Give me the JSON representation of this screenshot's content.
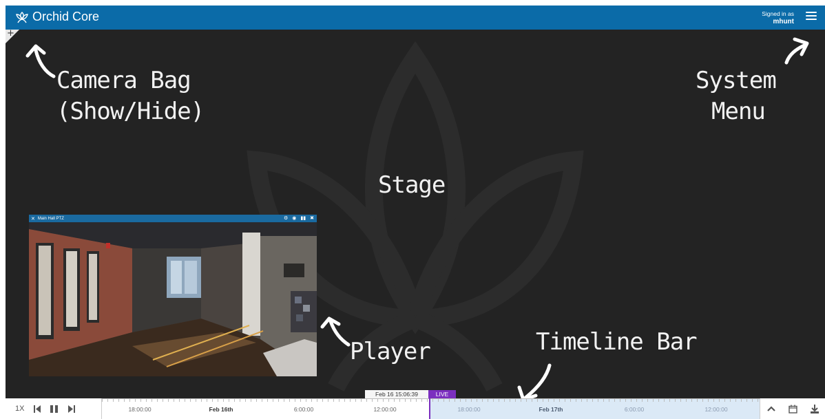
{
  "header": {
    "app_name": "Orchid Core",
    "signed_in_label": "Signed in as",
    "username": "mhunt"
  },
  "camera_bag": {
    "toggle_symbol": "+"
  },
  "annotations": {
    "camera_bag_line1": "Camera Bag",
    "camera_bag_line2": "(Show/Hide)",
    "system_menu_line1": "System",
    "system_menu_line2": "Menu",
    "stage": "Stage",
    "player": "Player",
    "timeline_bar": "Timeline Bar"
  },
  "player": {
    "title": "Main Hall PTZ",
    "icons": [
      "settings-icon",
      "camera-icon",
      "stats-icon",
      "close-icon"
    ]
  },
  "timeline": {
    "current_time": "Feb 16 15:06:39",
    "live_label": "LIVE",
    "speed": "1X",
    "labels": [
      "18:00:00",
      "Feb 16th",
      "6:00:00",
      "12:00:00",
      "18:00:00",
      "Feb 17th",
      "6:00:00",
      "12:00:00"
    ]
  },
  "colors": {
    "header": "#0b6ba8",
    "stage": "#232323",
    "live": "#7b2fbf",
    "live_region": "#dbe9f6"
  }
}
